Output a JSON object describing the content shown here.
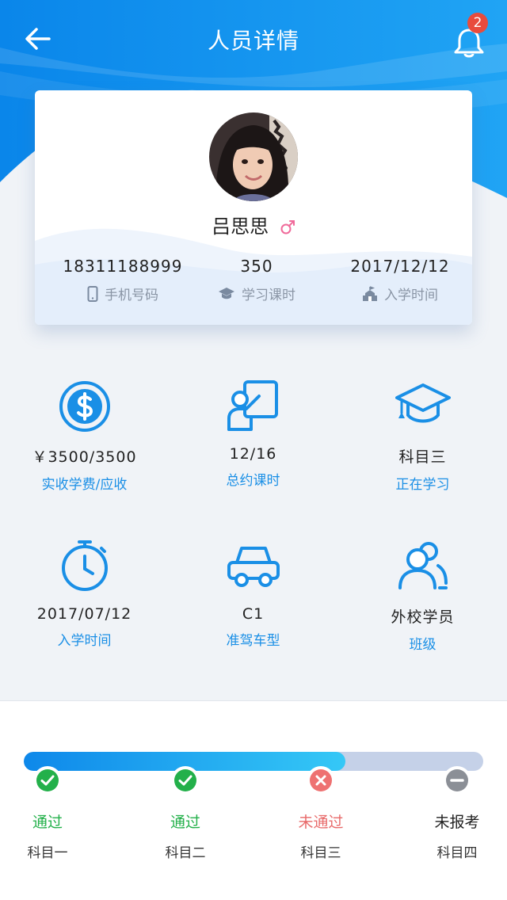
{
  "header": {
    "title": "人员详情",
    "notification_count": "2"
  },
  "profile": {
    "name": "吕思思",
    "gender": "male-symbol-icon",
    "phone": "18311188999",
    "phone_label": "手机号码",
    "hours": "350",
    "hours_label": "学习课时",
    "enroll_date": "2017/12/12",
    "enroll_label": "入学时间"
  },
  "grid": [
    {
      "icon": "dollar-coin-icon",
      "value": "￥3500/3500",
      "label": "实收学费/应收"
    },
    {
      "icon": "student-board-icon",
      "value": "12/16",
      "label": "总约课时"
    },
    {
      "icon": "graduation-cap-icon",
      "value": "科目三",
      "label": "正在学习"
    },
    {
      "icon": "stopwatch-icon",
      "value": "2017/07/12",
      "label": "入学时间"
    },
    {
      "icon": "car-icon",
      "value": "C1",
      "label": "准驾车型"
    },
    {
      "icon": "users-icon",
      "value": "外校学员",
      "label": "班级"
    }
  ],
  "progress": {
    "fill_fraction": 0.7,
    "steps": [
      {
        "status": "通过",
        "name": "科目一",
        "state": "passed",
        "color": "#23b04a"
      },
      {
        "status": "通过",
        "name": "科目二",
        "state": "passed",
        "color": "#23b04a"
      },
      {
        "status": "未通过",
        "name": "科目三",
        "state": "failed",
        "color": "#e86a6a"
      },
      {
        "status": "未报考",
        "name": "科目四",
        "state": "not-registered",
        "color": "#222222"
      }
    ]
  },
  "colors": {
    "accent": "#1a8fe6",
    "header_blue": "#1296ef",
    "passed": "#23b04a",
    "failed": "#e86a6a"
  }
}
